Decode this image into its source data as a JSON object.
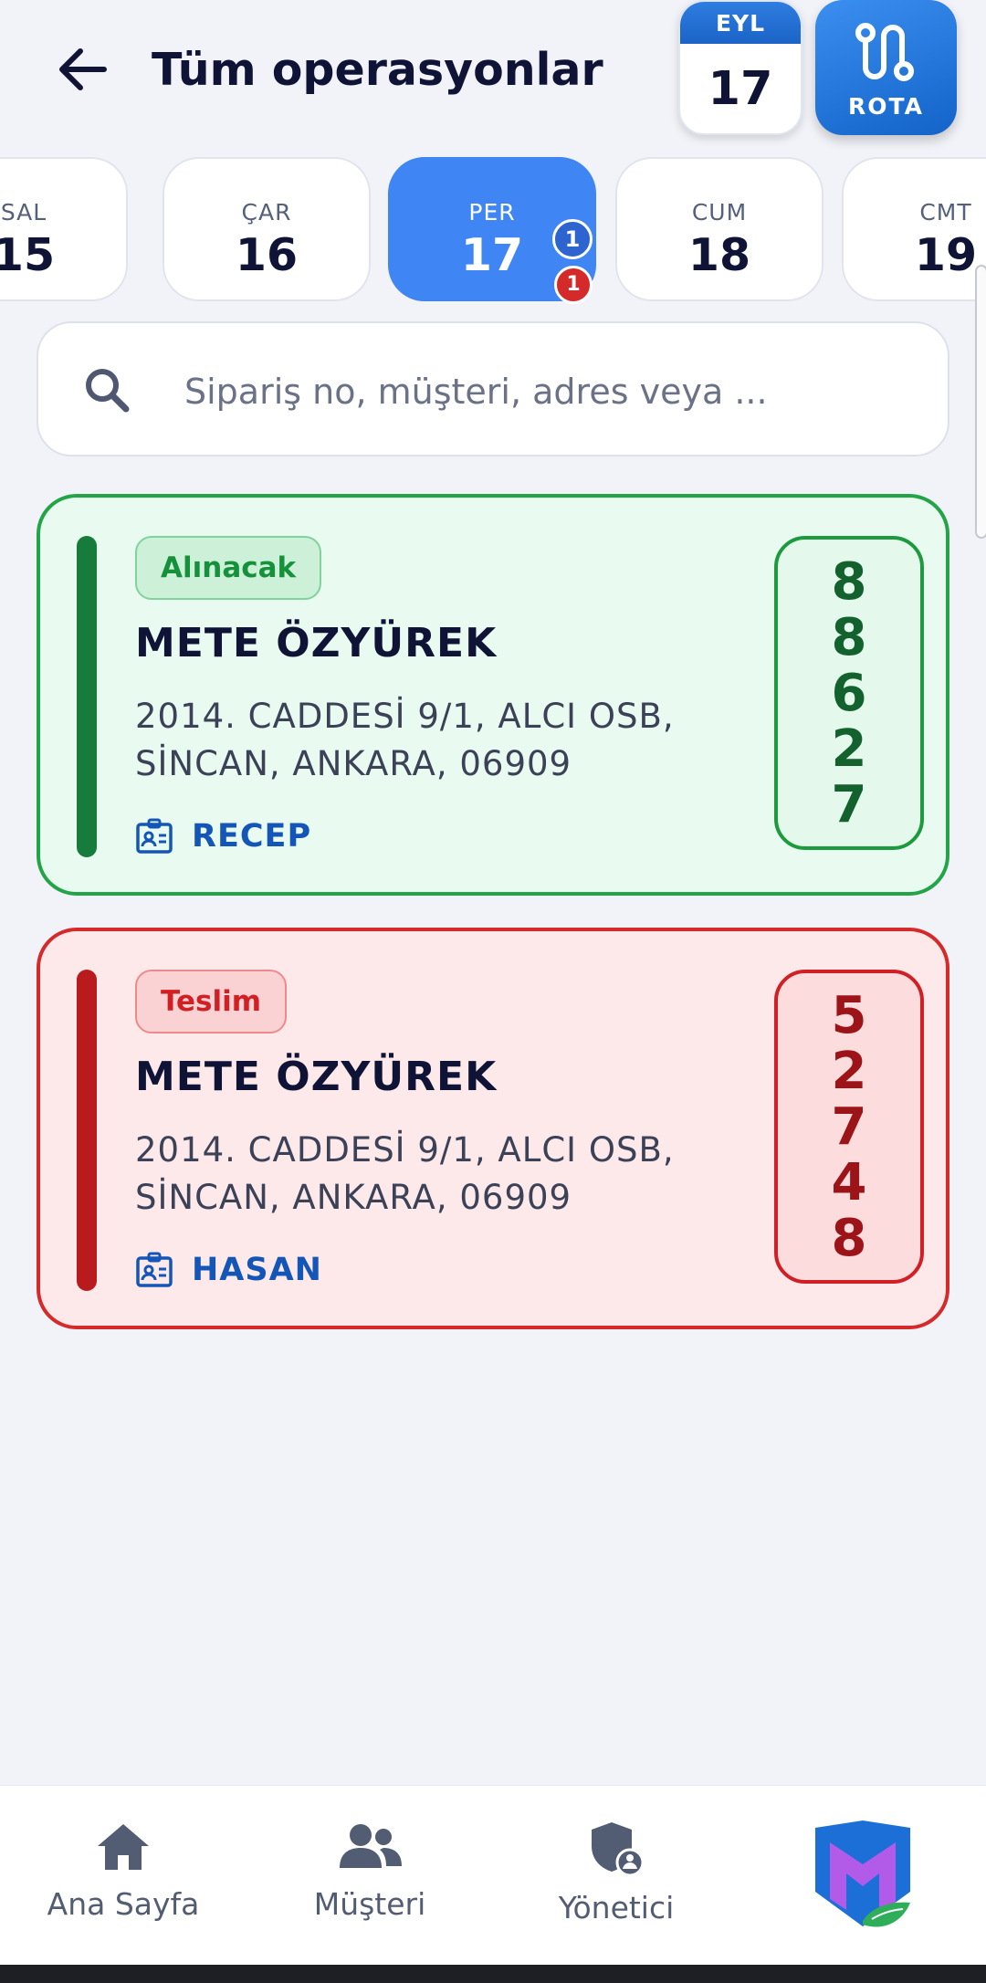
{
  "header": {
    "title": "Tüm operasyonlar",
    "calendar": {
      "month": "EYL",
      "day": "17"
    },
    "rota_label": "ROTA"
  },
  "days": [
    {
      "name": "SAL",
      "num": "15"
    },
    {
      "name": "ÇAR",
      "num": "16"
    },
    {
      "name": "PER",
      "num": "17",
      "active": true,
      "badges": {
        "blue": "1",
        "red": "1"
      }
    },
    {
      "name": "CUM",
      "num": "18"
    },
    {
      "name": "CMT",
      "num": "19"
    }
  ],
  "search": {
    "placeholder": "Sipariş no, müşteri, adres veya ...",
    "value": ""
  },
  "operations": [
    {
      "type": "Alınacak",
      "customer": "METE ÖZYÜREK",
      "address": "2014. CADDESİ 9/1, ALCI OSB, SİNCAN, ANKARA, 06909",
      "driver": "RECEP",
      "order_digits": [
        "8",
        "8",
        "6",
        "2",
        "7"
      ],
      "color": "#22a447"
    },
    {
      "type": "Teslim",
      "customer": "METE ÖZYÜREK",
      "address": "2014. CADDESİ 9/1, ALCI OSB, SİNCAN, ANKARA, 06909",
      "driver": "HASAN",
      "order_digits": [
        "5",
        "2",
        "7",
        "4",
        "8"
      ],
      "color": "#d42a2a"
    }
  ],
  "nav": {
    "items": [
      {
        "label": "Ana Sayfa",
        "icon": "home-icon"
      },
      {
        "label": "Müşteri",
        "icon": "users-icon"
      },
      {
        "label": "Yönetici",
        "icon": "admin-shield-icon"
      }
    ],
    "logo_icon": "app-logo-icon"
  },
  "colors": {
    "accent": "#3f86f4",
    "pickup": "#22a447",
    "delivery": "#d42a2a",
    "text": "#0f1436"
  }
}
